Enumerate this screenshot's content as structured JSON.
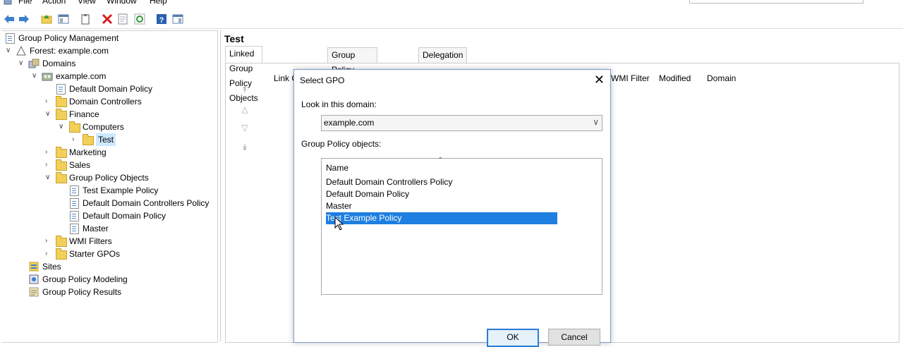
{
  "menu": [
    "File",
    "Action",
    "View",
    "Window",
    "Help"
  ],
  "toolbar": {
    "icons": [
      "back-arrow-icon",
      "forward-arrow-icon",
      "up-folder-icon",
      "show-hide-tree-icon",
      "clipboard-icon",
      "delete-icon",
      "properties-icon",
      "refresh-icon",
      "help-icon",
      "console-tree-icon"
    ]
  },
  "tree": {
    "root": "Group Policy Management",
    "forest": "Forest: example.com",
    "domains": "Domains",
    "domain": "example.com",
    "default_domain_policy": "Default Domain Policy",
    "domain_controllers": "Domain Controllers",
    "finance": "Finance",
    "computers": "Computers",
    "test": "Test",
    "marketing": "Marketing",
    "sales": "Sales",
    "gpo_container": "Group Policy Objects",
    "gpo_test_example": "Test Example Policy",
    "gpo_default_dc": "Default Domain Controllers Policy",
    "gpo_default_domain": "Default Domain Policy",
    "gpo_master": "Master",
    "wmi_filters": "WMI Filters",
    "starter_gpos": "Starter GPOs",
    "sites": "Sites",
    "modeling": "Group Policy Modeling",
    "results": "Group Policy Results"
  },
  "right": {
    "title": "Test",
    "tabs": [
      "Linked Group Policy Objects",
      "Group Policy Inheritance",
      "Delegation"
    ],
    "columns": {
      "link": "Link C",
      "wmi": "WMI Filter",
      "modified": "Modified",
      "domain": "Domain"
    }
  },
  "dialog": {
    "title": "Select GPO",
    "look_in_label": "Look in this domain:",
    "domain_value": "example.com",
    "gpo_label": "Group Policy objects:",
    "list_header": "Name",
    "items": [
      "Default Domain Controllers Policy",
      "Default Domain Policy",
      "Master",
      "Test Example Policy"
    ],
    "selected_index": 3,
    "ok": "OK",
    "cancel": "Cancel"
  }
}
